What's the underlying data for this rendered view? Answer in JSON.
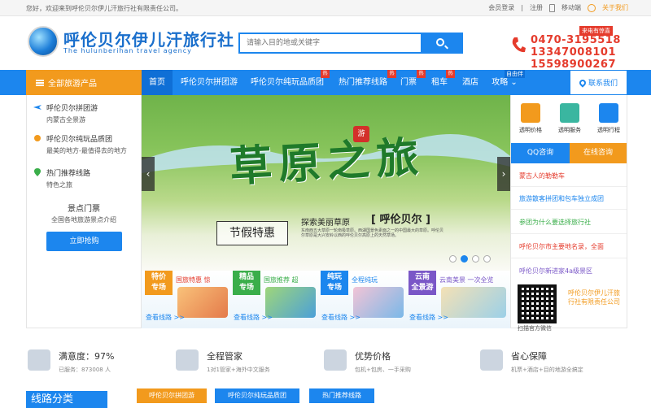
{
  "topbar": {
    "welcome": "您好，欢迎来到呼伦贝尔伊儿汗旅行社有限责任公司。",
    "login": "会员登录",
    "register": "注册",
    "mobile": "移动端",
    "follow": "关于我们"
  },
  "header": {
    "logo_title": "呼伦贝尔伊儿汗旅行社",
    "logo_sub": "The hulunberihan travel agency",
    "search_placeholder": "请输入目的地或关键字",
    "hotline_badge": "来电有惊喜",
    "phones": [
      "0470-3195518",
      "13347008101",
      "15598900267"
    ]
  },
  "nav": {
    "all_categories": "全部旅游产品",
    "items": [
      "首页",
      "呼伦贝尔拼团游",
      "呼伦贝尔纯玩品质团",
      "热门推荐线路",
      "门票",
      "租车",
      "酒店",
      "攻略"
    ],
    "hot_label": "热",
    "free_tag": "自由伴",
    "contact": "联系我们"
  },
  "sidebar": {
    "items": [
      {
        "title": "呼伦贝尔拼团游",
        "sub": "内蒙古全景游"
      },
      {
        "title": "呼伦贝尔纯玩品质团",
        "sub": "最美的地方-最值得去的地方"
      },
      {
        "title": "热门推荐线路",
        "sub": "特色之旅"
      }
    ],
    "ticket_title": "景点门票",
    "ticket_sub": "全国各地旅游景点介绍",
    "buy_button": "立即抢购"
  },
  "banner": {
    "slogan": "草原之旅",
    "seal": "游",
    "holiday": "节假特惠",
    "explore": "探索美丽草原",
    "explore_name": "呼伦贝尔",
    "desc": "东南西五大草原一轮南极草原。西湖国景色素面之一的中国最大的草原。呼伦贝尔草原是大兴安岭以西的呼伦贝尔高原上的天然草场。",
    "prev": "‹",
    "next": "›",
    "active_dot": 1
  },
  "promos": [
    {
      "tag1": "特价",
      "tag2": "专场",
      "title": "国旅特惠 惊",
      "link": "查看线路 >>",
      "color": "#f29a1d"
    },
    {
      "tag1": "精品",
      "tag2": "专场",
      "title": "国旅推荐 超",
      "link": "查看线路 >>",
      "color": "#3aae4a"
    },
    {
      "tag1": "纯玩",
      "tag2": "专场",
      "title": "全程纯玩 ",
      "link": "查看线路 >>",
      "color": "#1c86ee"
    },
    {
      "tag1": "云南",
      "tag2": "全景游",
      "title": "云南美景 一次全览",
      "link": "查看线路 >>",
      "color": "#7a57c7"
    }
  ],
  "rpanel": {
    "features": [
      {
        "label": "透明价格",
        "color": "#f29a1d"
      },
      {
        "label": "透明服务",
        "color": "#3ab6a0"
      },
      {
        "label": "透明行程",
        "color": "#1c86ee"
      }
    ],
    "qq": "QQ咨询",
    "online": "在线咨询",
    "news": [
      {
        "text": "蒙古人的勒勒车",
        "color": "#e53b2c"
      },
      {
        "text": "旅游散客拼团和包车独立成团",
        "color": "#1c86ee"
      },
      {
        "text": "参团为什么要选择旅行社",
        "color": "#3aae4a"
      },
      {
        "text": "呼伦贝尔市主要地名录，全面",
        "color": "#e53b2c"
      },
      {
        "text": "呼伦贝尔新进家4a级景区",
        "color": "#7a57c7"
      }
    ],
    "qr_text": "呼伦贝尔伊儿汗旅行社有限责任公司",
    "qr_caption": "扫描官方微信"
  },
  "promises": [
    {
      "title": "满意度：97%",
      "sub": "已服务：873008 人"
    },
    {
      "title": "全程管家",
      "sub": "1对1管家+海外中文服务"
    },
    {
      "title": "优势价格",
      "sub": "包机+包房、一手采购"
    },
    {
      "title": "省心保障",
      "sub": "机票+酒店+目的地游全搞定"
    }
  ],
  "routes": {
    "heading": "线路分类",
    "tabs": [
      "呼伦贝尔拼团游",
      "呼伦贝尔纯玩品质团",
      "热门推荐线路"
    ]
  }
}
